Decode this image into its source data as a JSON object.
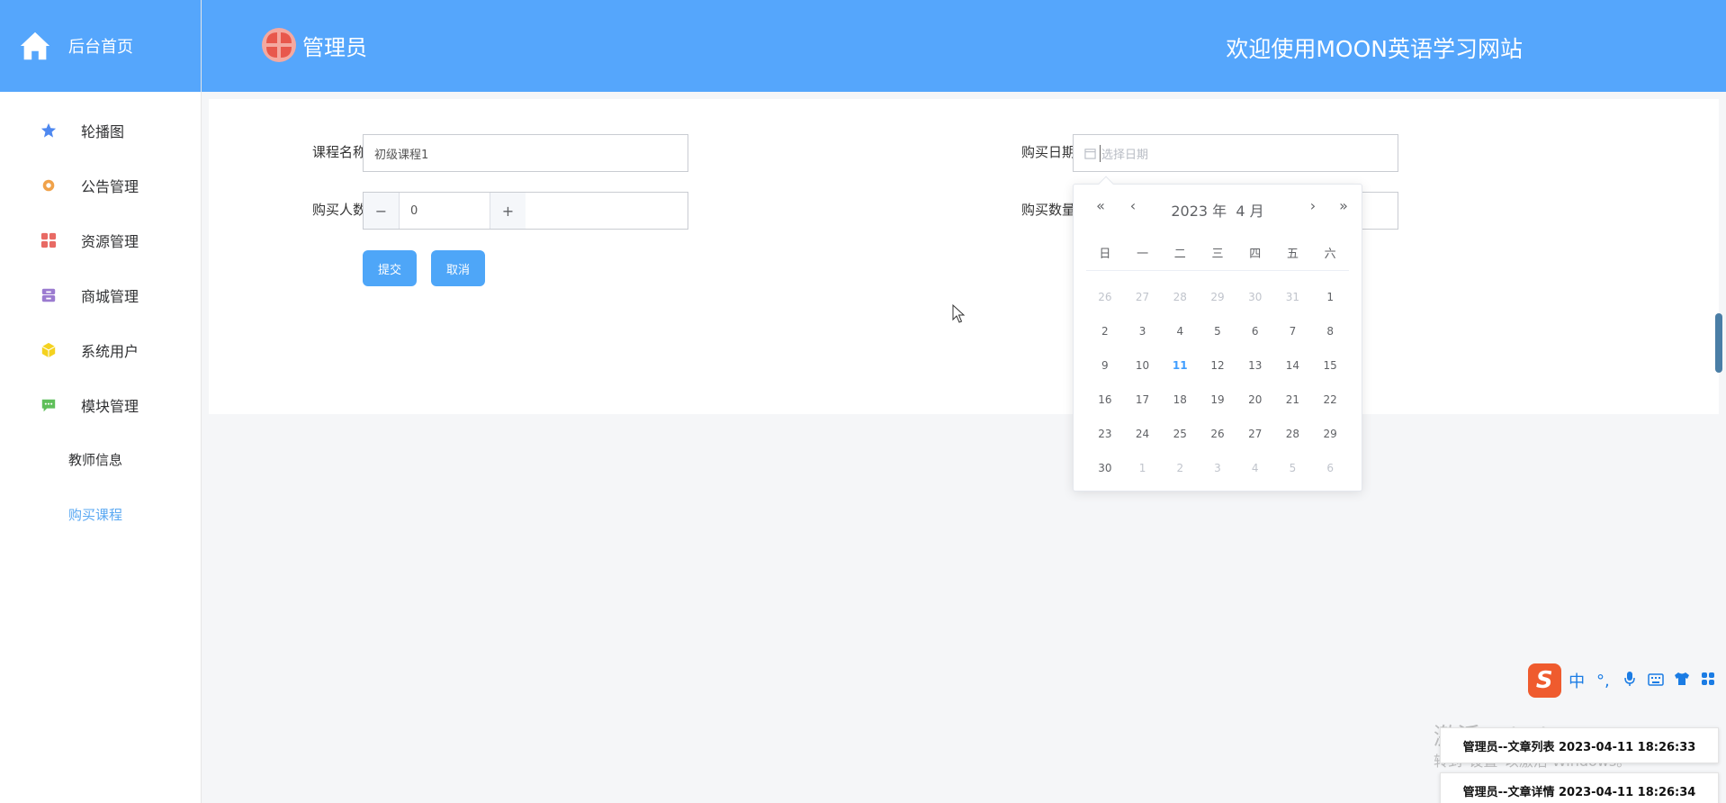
{
  "sidebar": {
    "brand_label": "后台首页",
    "items": [
      {
        "label": "轮播图",
        "icon": "star-icon",
        "color": "#4e88f0"
      },
      {
        "label": "公告管理",
        "icon": "gear-icon",
        "color": "#f0a24a"
      },
      {
        "label": "资源管理",
        "icon": "grid-icon",
        "color": "#e86a64"
      },
      {
        "label": "商城管理",
        "icon": "archive-icon",
        "color": "#9b7bd0"
      },
      {
        "label": "系统用户",
        "icon": "cube-icon",
        "color": "#f4d21f"
      },
      {
        "label": "模块管理",
        "icon": "chat-icon",
        "color": "#5fbf5a"
      },
      {
        "label": "教师信息"
      },
      {
        "label": "购买课程"
      }
    ]
  },
  "header": {
    "user_label": "管理员",
    "welcome": "欢迎使用MOON英语学习网站"
  },
  "form": {
    "course_name_label": "课程名称:",
    "course_name_value": "初级课程1",
    "buyers_label": "购买人数:",
    "buyers_value": "0",
    "minus": "−",
    "plus": "+",
    "date_label": "购买日期:",
    "date_placeholder": "选择日期",
    "qty_label": "购买数量:",
    "submit": "提交",
    "cancel": "取消"
  },
  "datepicker": {
    "title": "2023 年  4 月",
    "prev_year": "«",
    "prev_month": "‹",
    "next_month": "›",
    "next_year": "»",
    "weekdays": [
      "日",
      "一",
      "二",
      "三",
      "四",
      "五",
      "六"
    ],
    "days": [
      {
        "d": "26",
        "m": true
      },
      {
        "d": "27",
        "m": true
      },
      {
        "d": "28",
        "m": true
      },
      {
        "d": "29",
        "m": true
      },
      {
        "d": "30",
        "m": true
      },
      {
        "d": "31",
        "m": true
      },
      {
        "d": "1"
      },
      {
        "d": "2"
      },
      {
        "d": "3"
      },
      {
        "d": "4"
      },
      {
        "d": "5"
      },
      {
        "d": "6"
      },
      {
        "d": "7"
      },
      {
        "d": "8"
      },
      {
        "d": "9"
      },
      {
        "d": "10"
      },
      {
        "d": "11",
        "t": true
      },
      {
        "d": "12"
      },
      {
        "d": "13"
      },
      {
        "d": "14"
      },
      {
        "d": "15"
      },
      {
        "d": "16"
      },
      {
        "d": "17"
      },
      {
        "d": "18"
      },
      {
        "d": "19"
      },
      {
        "d": "20"
      },
      {
        "d": "21"
      },
      {
        "d": "22"
      },
      {
        "d": "23"
      },
      {
        "d": "24"
      },
      {
        "d": "25"
      },
      {
        "d": "26"
      },
      {
        "d": "27"
      },
      {
        "d": "28"
      },
      {
        "d": "29"
      },
      {
        "d": "30"
      },
      {
        "d": "1",
        "m": true
      },
      {
        "d": "2",
        "m": true
      },
      {
        "d": "3",
        "m": true
      },
      {
        "d": "4",
        "m": true
      },
      {
        "d": "5",
        "m": true
      },
      {
        "d": "6",
        "m": true
      }
    ]
  },
  "ime": {
    "logo": "S",
    "mode": "中",
    "punct": "°,",
    "icons": [
      "microphone-icon",
      "keyboard-icon",
      "shirt-icon",
      "apps-icon"
    ]
  },
  "watermark": {
    "line1": "激活 Windows",
    "line2": "转到\"设置\"以激活 Windows。"
  },
  "notifications": [
    "管理员--文章列表 2023-04-11 18:26:33",
    "管理员--文章详情 2023-04-11 18:26:34"
  ]
}
